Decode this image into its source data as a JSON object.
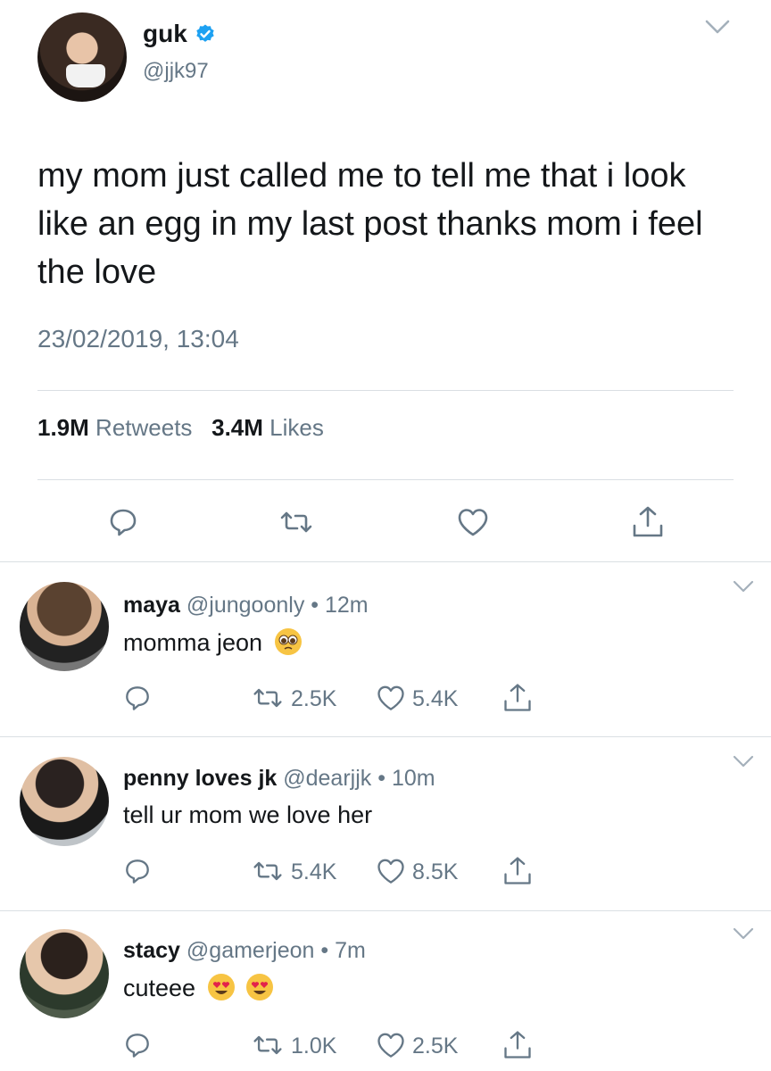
{
  "tweet": {
    "author_name": "guk",
    "author_handle": "@jjk97",
    "text": "my mom just called me to tell me that i look like an egg in my last post thanks mom i feel the love",
    "timestamp": "23/02/2019, 13:04",
    "retweets_count": "1.9M",
    "retweets_label": "Retweets",
    "likes_count": "3.4M",
    "likes_label": "Likes"
  },
  "replies": [
    {
      "name": "maya",
      "handle": "@jungoonly",
      "time": "12m",
      "text": "momma jeon",
      "emoji": [
        "pleading-face"
      ],
      "retweets": "2.5K",
      "likes": "5.4K"
    },
    {
      "name": "penny loves jk",
      "handle": "@dearjjk",
      "time": "10m",
      "text": "tell ur mom we love her",
      "emoji": [],
      "retweets": "5.4K",
      "likes": "8.5K"
    },
    {
      "name": "stacy",
      "handle": "@gamerjeon",
      "time": "7m",
      "text": "cuteee",
      "emoji": [
        "heart-eyes-face",
        "heart-eyes-face"
      ],
      "retweets": "1.0K",
      "likes": "2.5K"
    }
  ],
  "separator": "•",
  "colors": {
    "verified_blue": "#1da1f2",
    "secondary_text": "#657786",
    "divider": "#dadfe3"
  },
  "icons": [
    "verified-badge-icon",
    "chevron-down-icon",
    "reply-icon",
    "retweet-icon",
    "like-icon",
    "share-icon"
  ]
}
